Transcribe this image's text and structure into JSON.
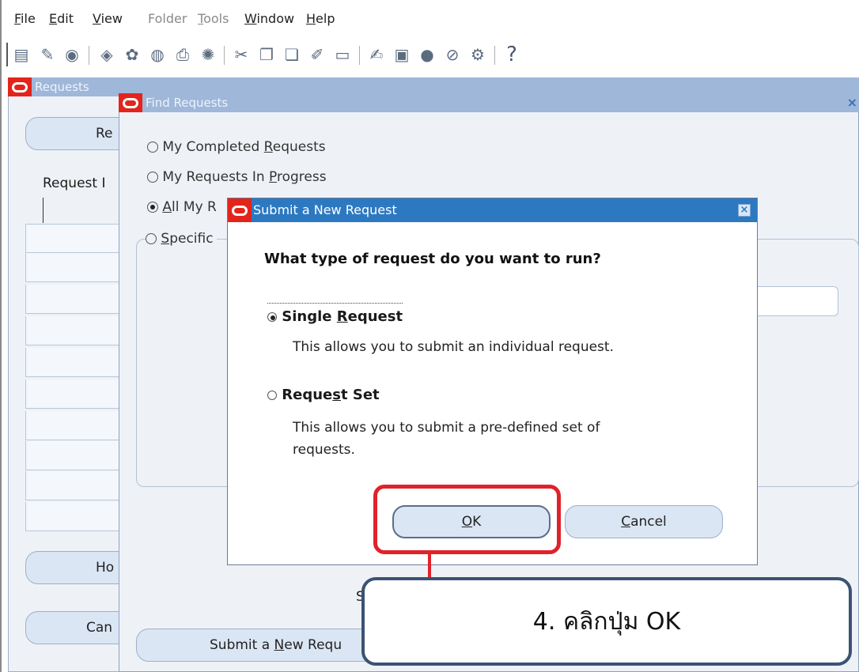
{
  "menubar": {
    "items": [
      {
        "label": "File",
        "ul": "F",
        "rest": "ile",
        "enabled": true
      },
      {
        "label": "Edit",
        "ul": "E",
        "rest": "dit",
        "enabled": true
      },
      {
        "label": "View",
        "ul": "V",
        "rest": "iew",
        "enabled": true
      },
      {
        "label": "Folder",
        "ul": "",
        "rest": "Folder",
        "enabled": false
      },
      {
        "label": "Tools",
        "ul": "T",
        "rest": "ools",
        "enabled": false
      },
      {
        "label": "Window",
        "ul": "W",
        "rest": "indow",
        "enabled": true
      },
      {
        "label": "Help",
        "ul": "H",
        "rest": "elp",
        "enabled": true
      }
    ]
  },
  "toolbar": {
    "icons": [
      "new-icon",
      "open-icon",
      "save-icon",
      "navigate-icon",
      "zoom-icon",
      "binoculars-icon",
      "print-icon",
      "close-form-icon",
      "cut-icon",
      "copy-icon",
      "paste-icon",
      "edit-icon",
      "clear-icon",
      "attach-edit-icon",
      "folder-icon",
      "translate-icon",
      "attachment-icon",
      "settings-icon",
      "help-icon"
    ],
    "help_glyph": "?"
  },
  "requests_window": {
    "title": "Requests",
    "refresh_label_partial": "Re",
    "request_col_partial": "Request I",
    "hold_label_partial": "Ho",
    "cancel_label_partial": "Can"
  },
  "find_window": {
    "title": "Find Requests",
    "close_glyph": "×",
    "options": {
      "completed": {
        "pre": "My Completed ",
        "ul": "R",
        "post": "equests"
      },
      "in_progress": {
        "pre": "My Requests In ",
        "ul": "P",
        "post": "rogress"
      },
      "all": {
        "pre": "",
        "ul": "A",
        "post": "ll My R"
      },
      "specific": {
        "pre": "",
        "ul": "S",
        "post": "pecific"
      }
    },
    "partial_s": "S",
    "submit_pre": "Submit a ",
    "submit_ul": "N",
    "submit_post": "ew Requ"
  },
  "dialog": {
    "title": "Submit a New Request",
    "close_glyph": "×",
    "question": "What type of request do you want to run?",
    "single": {
      "pre": "Single ",
      "ul": "R",
      "post": "equest",
      "desc": "This allows you to submit an individual request.",
      "selected": true
    },
    "set": {
      "pre": "Reque",
      "ul": "s",
      "post": "t Set",
      "desc_line1": "This allows you to submit a pre-defined set of",
      "desc_line2": "requests.",
      "selected": false
    },
    "ok_ul": "O",
    "ok_rest": "K",
    "cancel_ul": "C",
    "cancel_rest": "ancel"
  },
  "callout": {
    "text": "4. คลิกปุ่ม OK"
  }
}
